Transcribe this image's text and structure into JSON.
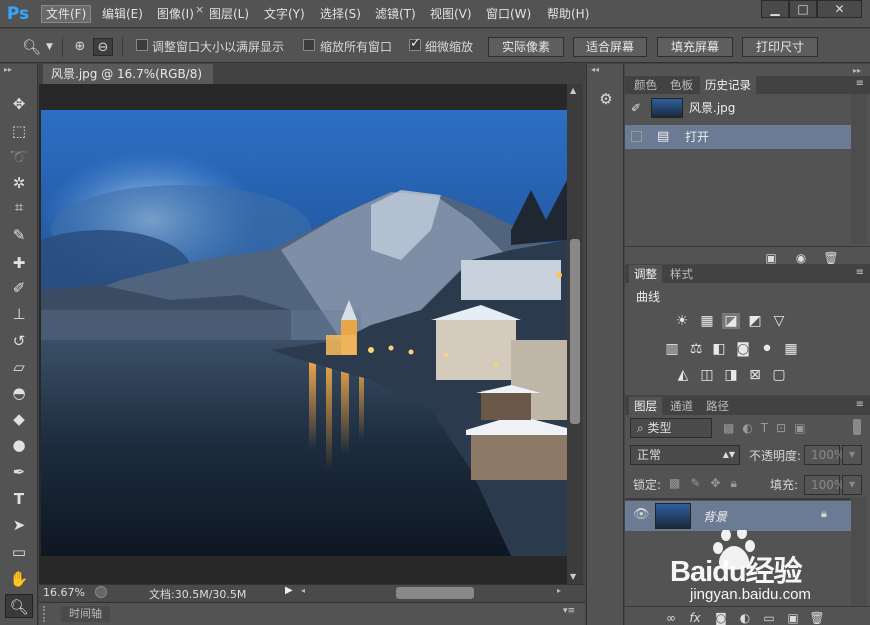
{
  "app": {
    "logo": "Ps"
  },
  "menu": [
    "文件(F)",
    "编辑(E)",
    "图像(I)",
    "图层(L)",
    "文字(Y)",
    "选择(S)",
    "滤镜(T)",
    "视图(V)",
    "窗口(W)",
    "帮助(H)"
  ],
  "window_controls": {
    "minimize": "▁",
    "maximize": "□",
    "close": "✕"
  },
  "options": {
    "resize_windows": "调整窗口大小以满屏显示",
    "zoom_all": "缩放所有窗口",
    "scrubby": "细微缩放",
    "btn_actual": "实际像素",
    "btn_fit": "适合屏幕",
    "btn_fill": "填充屏幕",
    "btn_print": "打印尺寸"
  },
  "document": {
    "tab_title": "风景.jpg @ 16.7%(RGB/8)",
    "close": "×",
    "zoom": "16.67%",
    "doc_info": "文档:30.5M/30.5M"
  },
  "timeline": {
    "label": "时间轴"
  },
  "history_panel": {
    "tabs": [
      "颜色",
      "色板",
      "历史记录"
    ],
    "snapshot_name": "风景.jpg",
    "steps": [
      "打开"
    ]
  },
  "adjust_panel": {
    "tabs": [
      "调整",
      "样式"
    ],
    "current": "曲线"
  },
  "layers_panel": {
    "tabs": [
      "图层",
      "通道",
      "路径"
    ],
    "filter_kind": "类型",
    "blend_mode": "正常",
    "opacity_label": "不透明度:",
    "opacity_value": "100%",
    "lock_label": "锁定:",
    "fill_label": "填充:",
    "fill_value": "100%",
    "layer_name": "背景"
  },
  "watermark": {
    "brand": "Baidu经验",
    "url": "jingyan.baidu.com"
  },
  "colors": {
    "accent": "#31a8ff",
    "panel_bg": "#535353",
    "selected_row": "#6b7b93"
  }
}
